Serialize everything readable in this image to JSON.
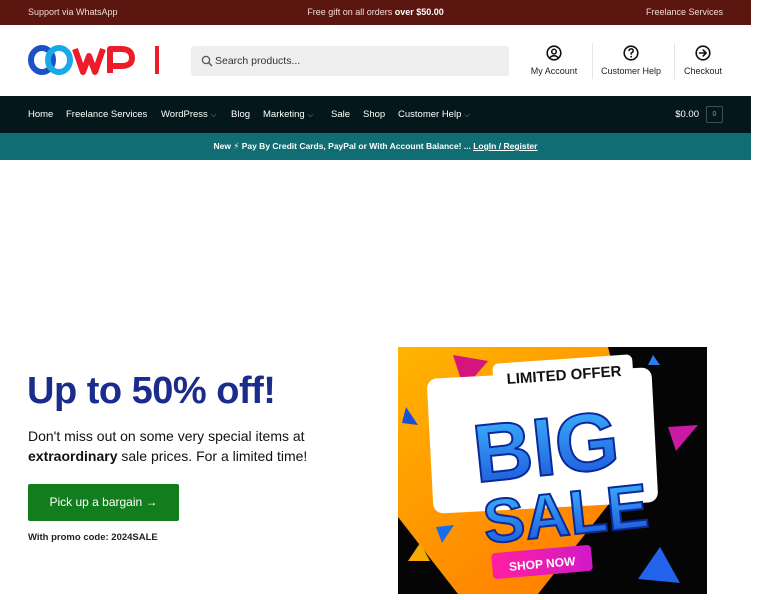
{
  "topbar": {
    "left": "Support via WhatsApp",
    "center_prefix": "Free gift on all orders ",
    "center_bold": "over $50.00",
    "right": "Freelance Services"
  },
  "header": {
    "search_placeholder": "Search products...",
    "items": [
      {
        "label": "My Account",
        "icon": "account-icon"
      },
      {
        "label": "Customer Help",
        "icon": "help-icon"
      },
      {
        "label": "Checkout",
        "icon": "arrow-right-circle-icon"
      }
    ]
  },
  "nav": {
    "items": [
      {
        "label": "Home",
        "dropdown": false
      },
      {
        "label": "Freelance Services",
        "dropdown": false
      },
      {
        "label": "WordPress",
        "dropdown": true
      },
      {
        "label": "Blog",
        "dropdown": false
      },
      {
        "label": "Marketing",
        "dropdown": true
      },
      {
        "label": "Sale",
        "dropdown": false
      },
      {
        "label": "Shop",
        "dropdown": false
      },
      {
        "label": "Customer Help",
        "dropdown": true
      }
    ],
    "cart_total": "$0.00",
    "cart_count": "0"
  },
  "notice": {
    "text": "New ⚡ Pay By Credit Cards, PayPal or With Account Balance! ... ",
    "link": "LogIn / Register"
  },
  "hero": {
    "title": "Up to 50% off!",
    "text_1": "Don't miss out on some very special items at ",
    "text_bold": "extraordinary",
    "text_2": " sale prices. For a limited time!",
    "button": "Pick up a bargain →",
    "promo": "With promo code: 2024SALE"
  },
  "banner": {
    "top": "LIMITED OFFER",
    "big1": "BIG",
    "big2": "SALE",
    "cta": "SHOP NOW"
  },
  "colors": {
    "topbar": "#5b1610",
    "nav": "#04181b",
    "notice": "#0f6d73",
    "title": "#1c2c8c",
    "button": "#117d1d"
  }
}
